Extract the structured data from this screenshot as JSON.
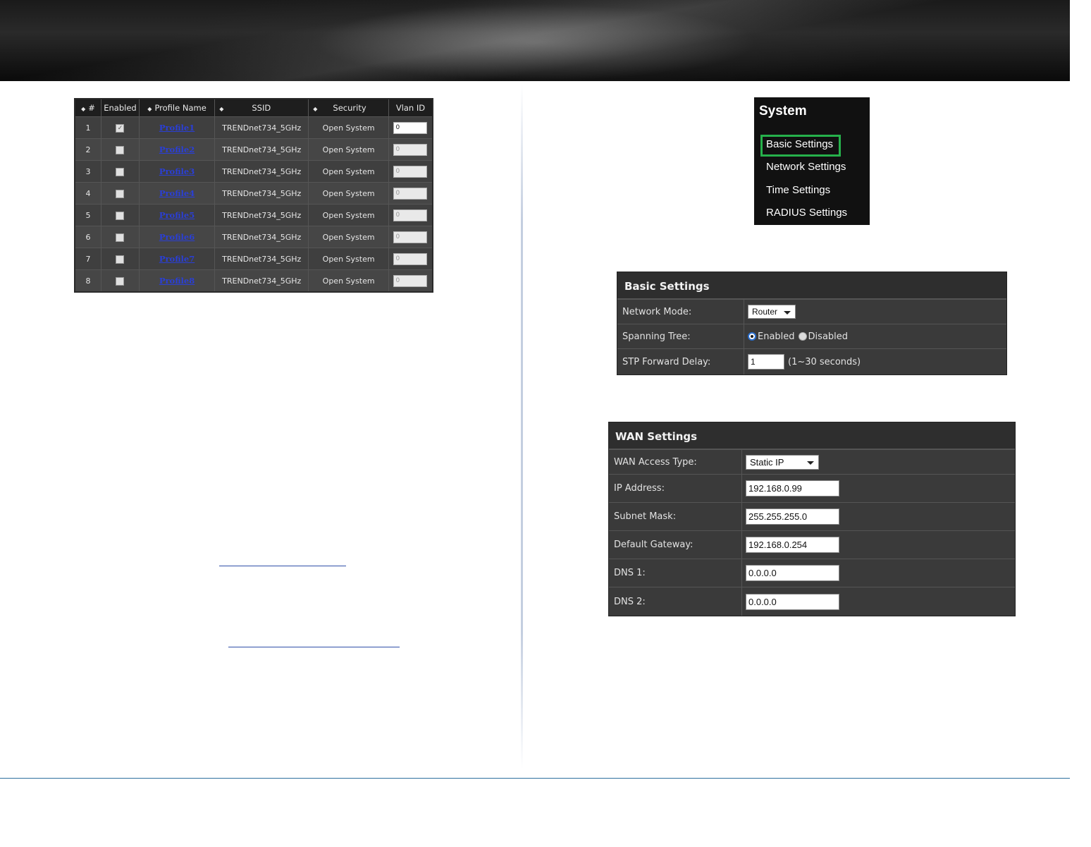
{
  "profiles_table": {
    "headers": {
      "num": "#",
      "enabled": "Enabled",
      "profile": "Profile Name",
      "ssid": "SSID",
      "security": "Security",
      "vlan": "Vlan ID"
    },
    "rows": [
      {
        "num": "1",
        "enabled": true,
        "profile": "Profile1",
        "ssid": "TRENDnet734_5GHz",
        "security": "Open System",
        "vlan": "0"
      },
      {
        "num": "2",
        "enabled": false,
        "profile": "Profile2",
        "ssid": "TRENDnet734_5GHz",
        "security": "Open System",
        "vlan": "0"
      },
      {
        "num": "3",
        "enabled": false,
        "profile": "Profile3",
        "ssid": "TRENDnet734_5GHz",
        "security": "Open System",
        "vlan": "0"
      },
      {
        "num": "4",
        "enabled": false,
        "profile": "Profile4",
        "ssid": "TRENDnet734_5GHz",
        "security": "Open System",
        "vlan": "0"
      },
      {
        "num": "5",
        "enabled": false,
        "profile": "Profile5",
        "ssid": "TRENDnet734_5GHz",
        "security": "Open System",
        "vlan": "0"
      },
      {
        "num": "6",
        "enabled": false,
        "profile": "Profile6",
        "ssid": "TRENDnet734_5GHz",
        "security": "Open System",
        "vlan": "0"
      },
      {
        "num": "7",
        "enabled": false,
        "profile": "Profile7",
        "ssid": "TRENDnet734_5GHz",
        "security": "Open System",
        "vlan": "0"
      },
      {
        "num": "8",
        "enabled": false,
        "profile": "Profile8",
        "ssid": "TRENDnet734_5GHz",
        "security": "Open System",
        "vlan": "0"
      }
    ]
  },
  "system_menu": {
    "title": "System",
    "items": [
      "Basic Settings",
      "Network Settings",
      "Time Settings",
      "RADIUS Settings"
    ],
    "highlighted": "Basic Settings",
    "highlight_color": "#26b14b"
  },
  "basic_settings": {
    "title": "Basic Settings",
    "network_mode_label": "Network Mode:",
    "network_mode_value": "Router",
    "spanning_tree_label": "Spanning Tree:",
    "spanning_enabled": "Enabled",
    "spanning_disabled": "Disabled",
    "stp_label": "STP Forward Delay:",
    "stp_value": "1",
    "stp_hint": "(1~30 seconds)"
  },
  "wan_settings": {
    "title": "WAN Settings",
    "rows": [
      {
        "label": "WAN Access Type:",
        "value": "Static IP"
      },
      {
        "label": "IP Address:",
        "value": "192.168.0.99"
      },
      {
        "label": "Subnet Mask:",
        "value": "255.255.255.0"
      },
      {
        "label": "Default Gateway:",
        "value": "192.168.0.254"
      },
      {
        "label": "DNS 1:",
        "value": "0.0.0.0"
      },
      {
        "label": "DNS 2:",
        "value": "0.0.0.0"
      }
    ]
  },
  "colors": {
    "link": "#2a3fd6",
    "footer_line": "#2d6f9e",
    "panel_bg": "#3a3a3a"
  }
}
